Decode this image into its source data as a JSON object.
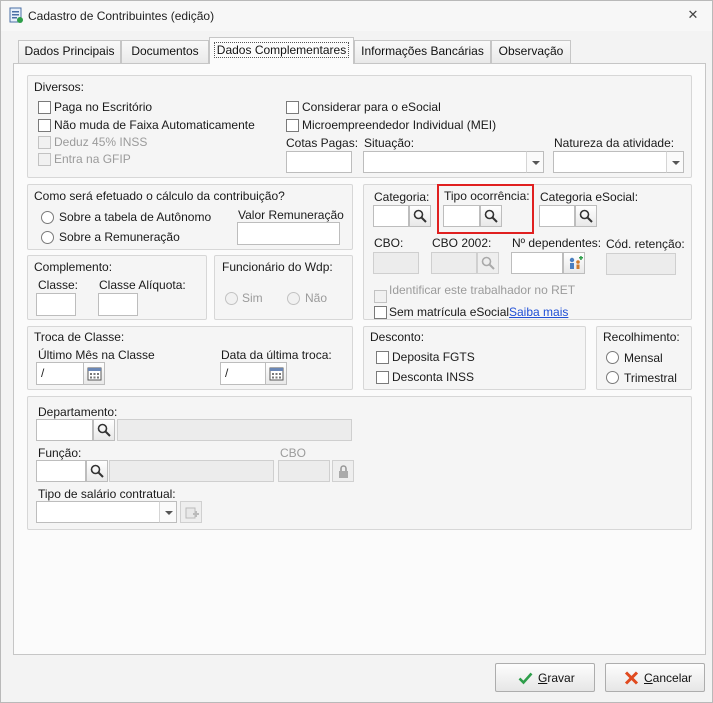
{
  "window": {
    "title": "Cadastro de Contribuintes (edição)"
  },
  "tabs": [
    {
      "label": "Dados Principais"
    },
    {
      "label": "Documentos"
    },
    {
      "label": "Dados Complementares"
    },
    {
      "label": "Informações Bancárias"
    },
    {
      "label": "Observação"
    }
  ],
  "diversos": {
    "title": "Diversos:",
    "paga_escritorio": "Paga no Escritório",
    "nao_muda_faixa": "Não muda de Faixa Automaticamente",
    "deduz_inss": "Deduz 45% INSS",
    "entra_gfip": "Entra na GFIP",
    "considerar_esocial": "Considerar para o eSocial",
    "mei": "Microempreendedor Individual (MEI)",
    "cotas_pagas": "Cotas Pagas:",
    "situacao": "Situação:",
    "natureza": "Natureza da atividade:"
  },
  "calculo": {
    "title": "Como será efetuado o cálculo da contribuição?",
    "autonomo": "Sobre a tabela de Autônomo",
    "remuneracao": "Sobre a Remuneração",
    "valor_remuneracao": "Valor Remuneração"
  },
  "complemento": {
    "title": "Complemento:",
    "classe": "Classe:",
    "classe_aliquota": "Classe Alíquota:"
  },
  "funcionario": {
    "title": "Funcionário do Wdp:",
    "sim": "Sim",
    "nao": "Não"
  },
  "categoria": {
    "categoria": "Categoria:",
    "tipo_ocorrencia": "Tipo ocorrência:",
    "categoria_esocial": "Categoria eSocial:",
    "cbo": "CBO:",
    "cbo2002": "CBO 2002:",
    "dependentes": "Nº dependentes:",
    "cod_retencao": "Cód. retenção:",
    "identificar_ret": "Identificar este trabalhador no RET",
    "sem_matricula": "Sem matrícula eSocial",
    "saiba_mais": "Saiba mais"
  },
  "troca": {
    "title": "Troca de Classe:",
    "ultimo_mes": "Último Mês na Classe",
    "data_ultima": "Data da última troca:",
    "ultimo_mes_value": "/",
    "data_ultima_value": "/"
  },
  "desconto": {
    "title": "Desconto:",
    "fgts": "Deposita FGTS",
    "inss": "Desconta INSS"
  },
  "recolhimento": {
    "title": "Recolhimento:",
    "mensal": "Mensal",
    "trimestral": "Trimestral"
  },
  "depto": {
    "departamento": "Departamento:",
    "funcao": "Função:",
    "cbo": "CBO",
    "tipo_salario": "Tipo de salário contratual:"
  },
  "buttons": {
    "gravar_pre": "",
    "gravar_u": "G",
    "gravar_post": "ravar",
    "cancelar_pre": "",
    "cancelar_u": "C",
    "cancelar_post": "ancelar"
  },
  "colors": {
    "highlight": "#e02020",
    "link": "#1f4fd6"
  }
}
